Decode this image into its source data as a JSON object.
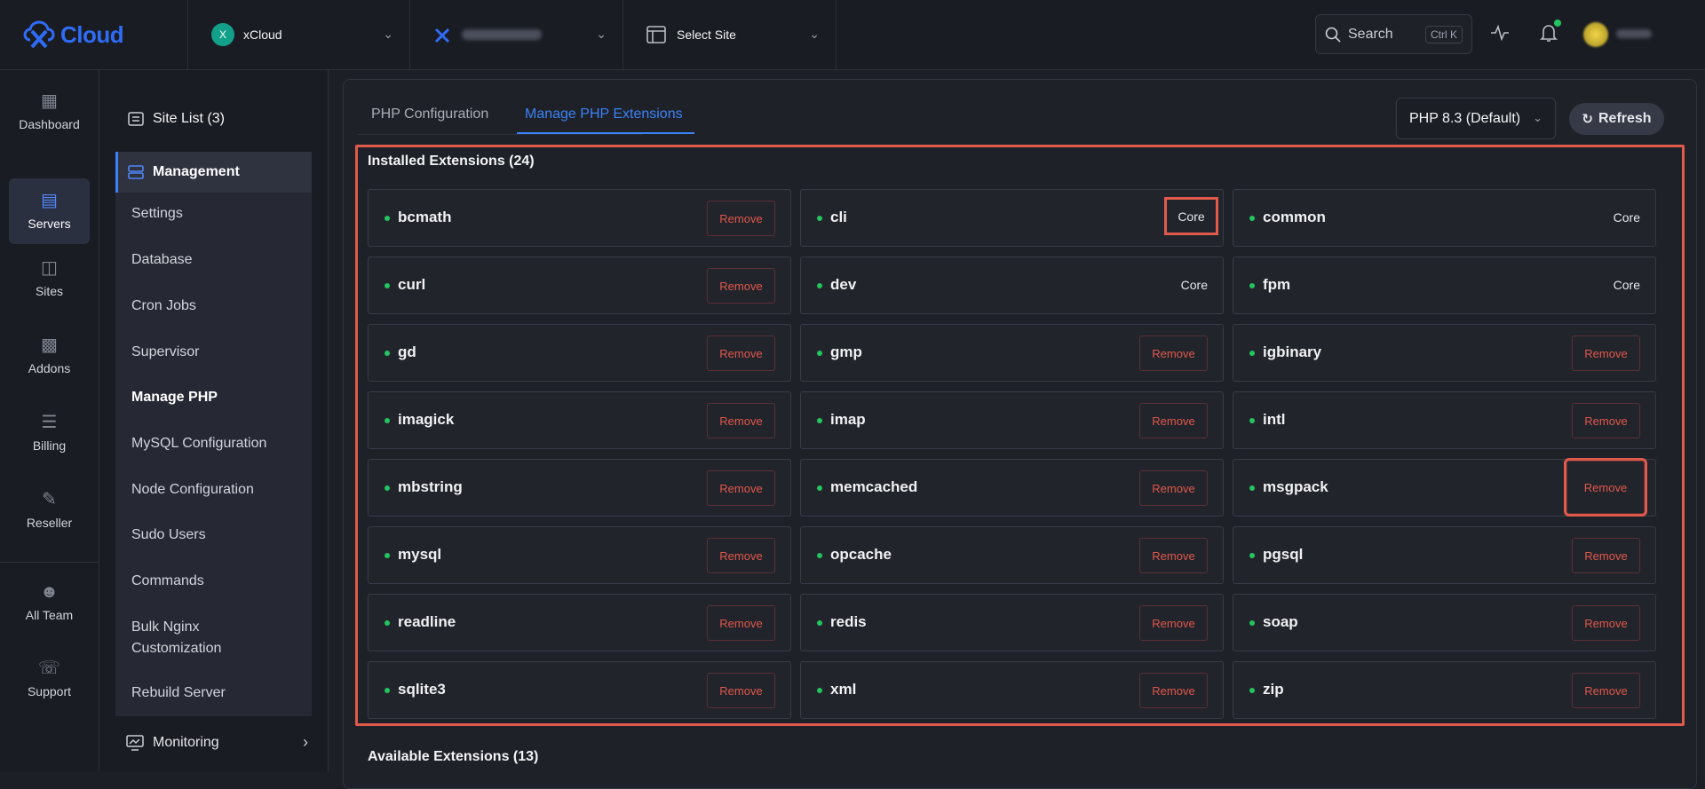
{
  "brand": {
    "name": "Cloud",
    "color": "#2f6cf5"
  },
  "topbar": {
    "workspace": {
      "avatar_letter": "X",
      "name": "xCloud"
    },
    "site": {
      "label": "Select Site"
    },
    "search": {
      "label": "Search",
      "shortcut": "Ctrl K"
    }
  },
  "rail": {
    "items": [
      {
        "label": "Dashboard",
        "icon": "grid-icon"
      },
      {
        "label": "Servers",
        "icon": "server-icon",
        "active": true
      },
      {
        "label": "Sites",
        "icon": "layout-icon"
      },
      {
        "label": "Addons",
        "icon": "puzzle-icon"
      },
      {
        "label": "Billing",
        "icon": "receipt-icon"
      },
      {
        "label": "Reseller",
        "icon": "reseller-icon"
      },
      {
        "label": "All Team",
        "icon": "team-icon"
      },
      {
        "label": "Support",
        "icon": "headset-icon"
      }
    ]
  },
  "subnav": {
    "site_list": "Site List (3)",
    "management": "Management",
    "items": [
      "Settings",
      "Database",
      "Cron Jobs",
      "Supervisor",
      "Manage PHP",
      "MySQL Configuration",
      "Node Configuration",
      "Sudo Users",
      "Commands",
      "Bulk Nginx Customization",
      "Rebuild Server"
    ],
    "active_item": "Manage PHP",
    "monitoring": "Monitoring"
  },
  "main": {
    "tabs": [
      "PHP Configuration",
      "Manage PHP Extensions"
    ],
    "active_tab": "Manage PHP Extensions",
    "php_version": "PHP 8.3 (Default)",
    "refresh_label": "Refresh",
    "installed_title": "Installed Extensions (24)",
    "available_title": "Available Extensions (13)",
    "remove_label": "Remove",
    "core_label": "Core",
    "extensions": [
      {
        "name": "bcmath",
        "type": "remove"
      },
      {
        "name": "cli",
        "type": "core",
        "highlight": true
      },
      {
        "name": "common",
        "type": "core"
      },
      {
        "name": "curl",
        "type": "remove"
      },
      {
        "name": "dev",
        "type": "core"
      },
      {
        "name": "fpm",
        "type": "core"
      },
      {
        "name": "gd",
        "type": "remove"
      },
      {
        "name": "gmp",
        "type": "remove"
      },
      {
        "name": "igbinary",
        "type": "remove"
      },
      {
        "name": "imagick",
        "type": "remove"
      },
      {
        "name": "imap",
        "type": "remove"
      },
      {
        "name": "intl",
        "type": "remove"
      },
      {
        "name": "mbstring",
        "type": "remove"
      },
      {
        "name": "memcached",
        "type": "remove"
      },
      {
        "name": "msgpack",
        "type": "remove",
        "highlight": true
      },
      {
        "name": "mysql",
        "type": "remove"
      },
      {
        "name": "opcache",
        "type": "remove"
      },
      {
        "name": "pgsql",
        "type": "remove"
      },
      {
        "name": "readline",
        "type": "remove"
      },
      {
        "name": "redis",
        "type": "remove"
      },
      {
        "name": "soap",
        "type": "remove"
      },
      {
        "name": "sqlite3",
        "type": "remove"
      },
      {
        "name": "xml",
        "type": "remove"
      },
      {
        "name": "zip",
        "type": "remove"
      }
    ]
  },
  "colors": {
    "accent": "#3b82f6",
    "danger": "#e0574a",
    "status_ok": "#22c55e",
    "highlight": "#e05a4c"
  }
}
